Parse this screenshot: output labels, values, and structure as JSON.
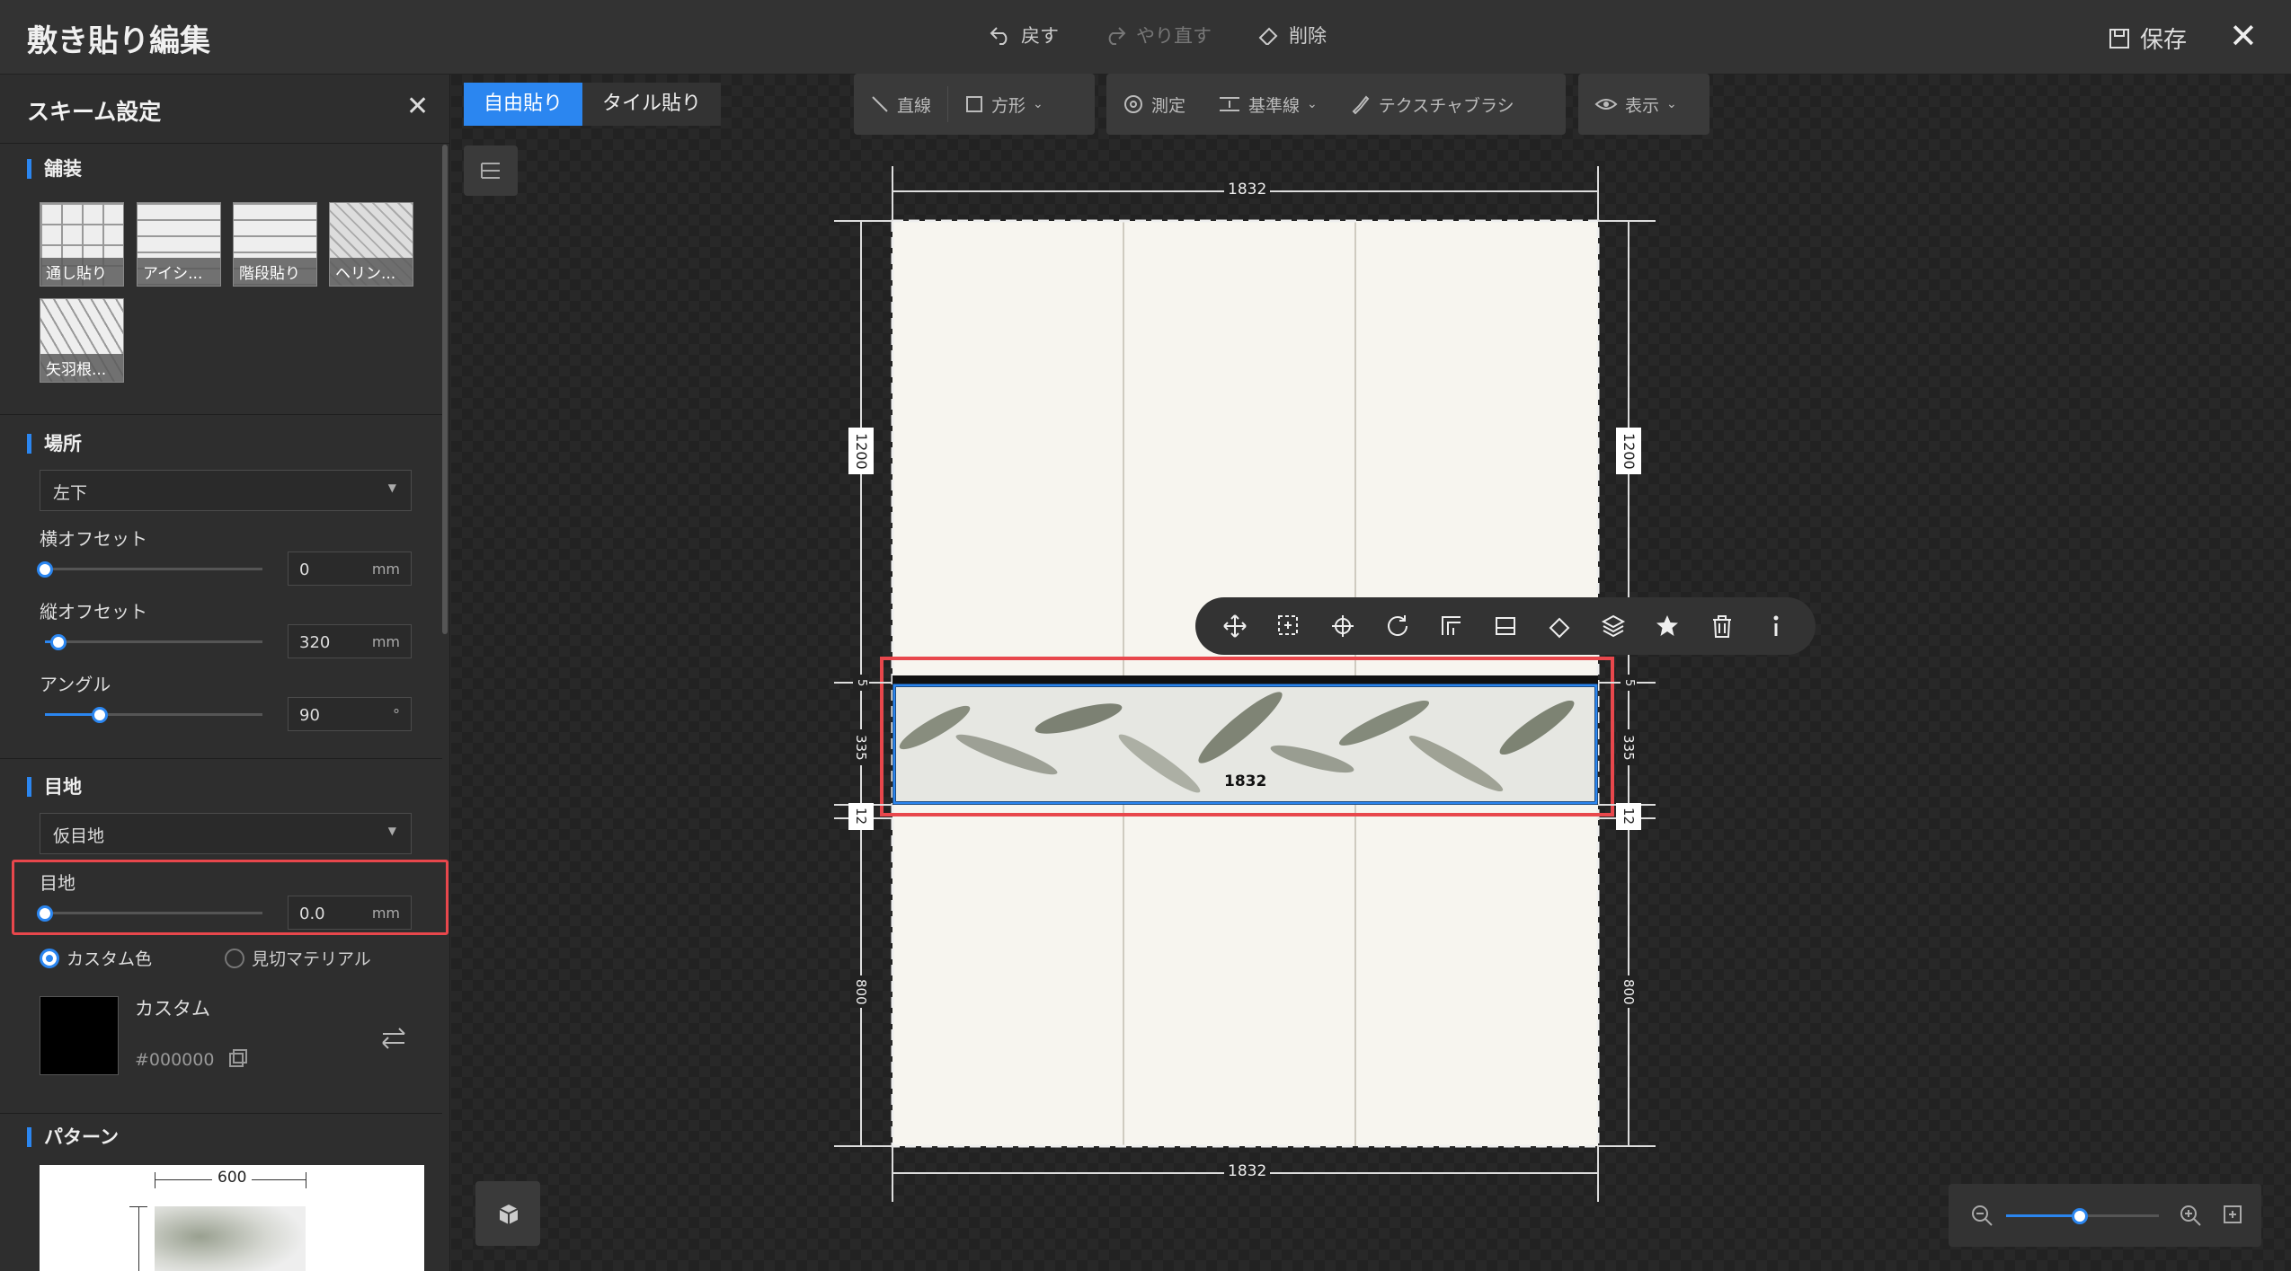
{
  "app": {
    "title": "敷き貼り編集",
    "undo": "戻す",
    "redo": "やり直す",
    "delete": "削除",
    "save": "保存"
  },
  "sidebar": {
    "title": "スキーム設定",
    "paving": {
      "title": "舗装",
      "patterns": [
        "通し貼り",
        "アイシ...",
        "階段貼り",
        "ヘリン...",
        "矢羽根..."
      ]
    },
    "location": {
      "title": "場所",
      "selected": "左下",
      "h_offset_label": "横オフセット",
      "h_offset_value": "0",
      "v_offset_label": "縦オフセット",
      "v_offset_value": "320",
      "angle_label": "アングル",
      "angle_value": "90",
      "unit": "mm",
      "angle_unit": "°",
      "h_offset_slider": 0.0,
      "v_offset_slider": 0.06,
      "angle_slider": 0.25
    },
    "joint": {
      "title": "目地",
      "selected": "仮目地",
      "width_label": "目地",
      "width_value": "0.0",
      "width_slider": 0.0,
      "unit": "mm",
      "radio_custom": "カスタム色",
      "radio_material": "見切マテリアル",
      "color_name": "カスタム",
      "color_hex": "#000000"
    },
    "pattern_section": {
      "title": "パターン",
      "width": "600"
    }
  },
  "editor": {
    "tabs": [
      "自由貼り",
      "タイル貼り"
    ],
    "tools": {
      "line": "直線",
      "rect": "方形",
      "measure": "測定",
      "guideline": "基準線",
      "texture_brush": "テクスチャブラシ",
      "view": "表示"
    },
    "dims": {
      "top": "1832",
      "bottom": "1832",
      "left_top": "1200",
      "right_top": "1200",
      "left_mid": "335",
      "right_mid": "335",
      "left_small": "12",
      "right_small": "12",
      "left_bottom": "800",
      "right_bottom": "800",
      "left_tiny": "5",
      "right_tiny": "5",
      "strip": "1832"
    },
    "zoom_level": 0.48
  },
  "colors": {
    "accent": "#2b86f0",
    "highlight": "#e8474c"
  }
}
